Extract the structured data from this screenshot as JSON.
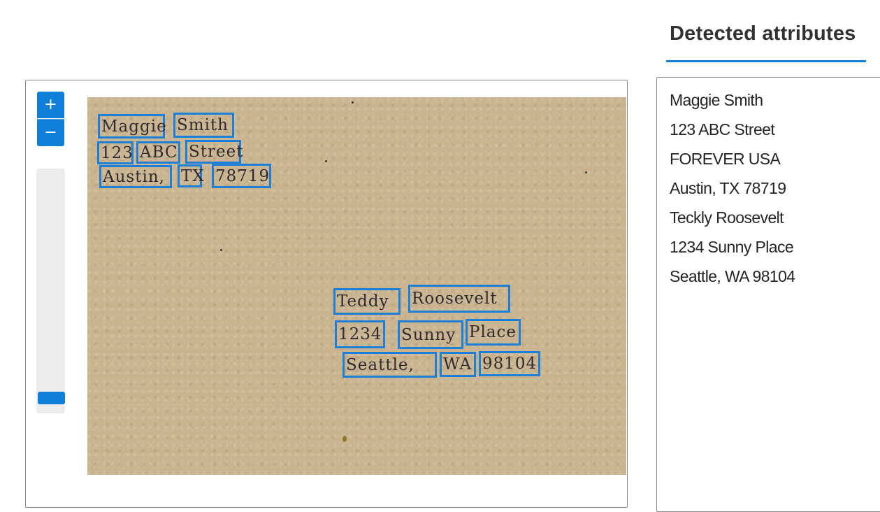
{
  "zoom": {
    "in_label": "+",
    "out_label": "−",
    "level": 0.95
  },
  "document": {
    "words": [
      {
        "text": "Maggie"
      },
      {
        "text": "Smith"
      },
      {
        "text": "123"
      },
      {
        "text": "ABC"
      },
      {
        "text": "Street"
      },
      {
        "text": "Austin,"
      },
      {
        "text": "TX"
      },
      {
        "text": "78719"
      },
      {
        "text": "Teddy"
      },
      {
        "text": "Roosevelt"
      },
      {
        "text": "1234"
      },
      {
        "text": "Sunny"
      },
      {
        "text": "Place"
      },
      {
        "text": "Seattle,"
      },
      {
        "text": "WA"
      },
      {
        "text": "98104"
      }
    ]
  },
  "panel": {
    "title": "Detected attributes",
    "attributes": [
      "Maggie Smith",
      "123 ABC Street",
      "FOREVER USA",
      "Austin, TX 78719",
      "Teckly Roosevelt",
      "1234 Sunny Place",
      "Seattle, WA 98104"
    ]
  },
  "colors": {
    "accent": "#0f7fd9",
    "box": "#1e7fd6",
    "paper": "#c9b48f"
  }
}
